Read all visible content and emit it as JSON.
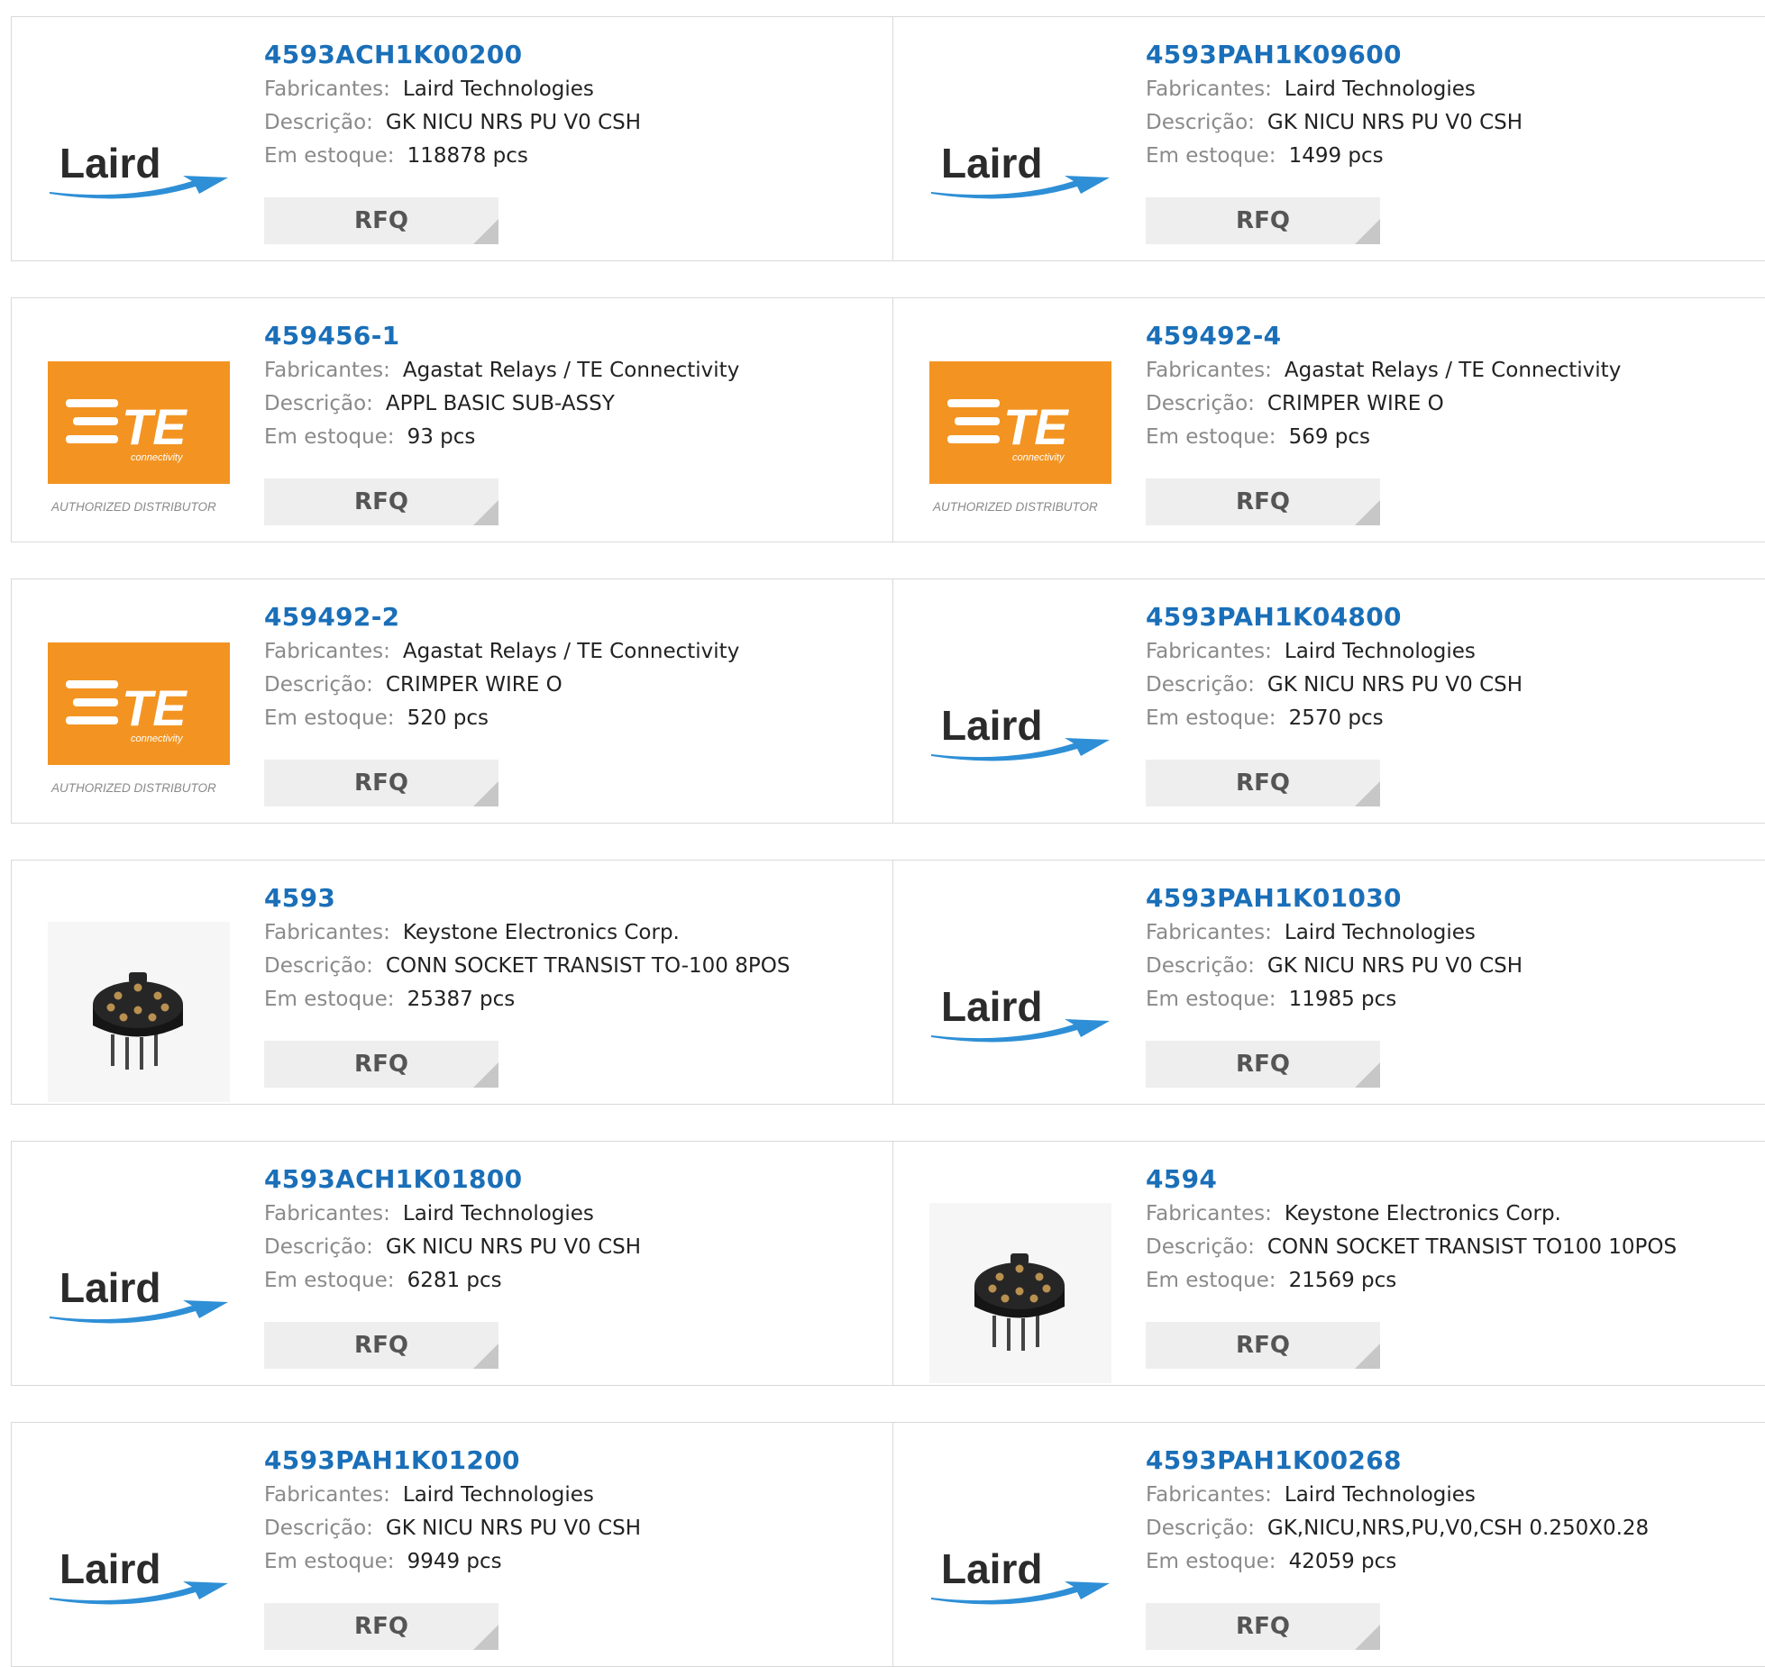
{
  "labels": {
    "manufacturer": "Fabricantes:",
    "description": "Descrição:",
    "stock": "Em estoque:",
    "rfq": "RFQ"
  },
  "logo_text": {
    "laird": "Laird",
    "te": "TE",
    "te_sub": "connectivity",
    "te_tagline": "AUTHORIZED DISTRIBUTOR"
  },
  "products": [
    {
      "part": "4593ACH1K00200",
      "manufacturer": "Laird Technologies",
      "description": "GK NICU NRS PU V0 CSH",
      "stock": "118878 pcs",
      "logo": "laird-logo"
    },
    {
      "part": "4593PAH1K09600",
      "manufacturer": "Laird Technologies",
      "description": "GK NICU NRS PU V0 CSH",
      "stock": "1499 pcs",
      "logo": "laird-logo"
    },
    {
      "part": "459456-1",
      "manufacturer": "Agastat Relays / TE Connectivity",
      "description": "APPL BASIC SUB-ASSY",
      "stock": "93 pcs",
      "logo": "te-logo"
    },
    {
      "part": "459492-4",
      "manufacturer": "Agastat Relays / TE Connectivity",
      "description": "CRIMPER WIRE O",
      "stock": "569 pcs",
      "logo": "te-logo"
    },
    {
      "part": "459492-2",
      "manufacturer": "Agastat Relays / TE Connectivity",
      "description": "CRIMPER WIRE O",
      "stock": "520 pcs",
      "logo": "te-logo"
    },
    {
      "part": "4593PAH1K04800",
      "manufacturer": "Laird Technologies",
      "description": "GK NICU NRS PU V0 CSH",
      "stock": "2570 pcs",
      "logo": "laird-logo"
    },
    {
      "part": "4593",
      "manufacturer": "Keystone Electronics Corp.",
      "description": "CONN SOCKET TRANSIST TO-100 8POS",
      "stock": "25387 pcs",
      "logo": "socket-image"
    },
    {
      "part": "4593PAH1K01030",
      "manufacturer": "Laird Technologies",
      "description": "GK NICU NRS PU V0 CSH",
      "stock": "11985 pcs",
      "logo": "laird-logo"
    },
    {
      "part": "4593ACH1K01800",
      "manufacturer": "Laird Technologies",
      "description": "GK NICU NRS PU V0 CSH",
      "stock": "6281 pcs",
      "logo": "laird-logo"
    },
    {
      "part": "4594",
      "manufacturer": "Keystone Electronics Corp.",
      "description": "CONN SOCKET TRANSIST TO100 10POS",
      "stock": "21569 pcs",
      "logo": "socket-image"
    },
    {
      "part": "4593PAH1K01200",
      "manufacturer": "Laird Technologies",
      "description": "GK NICU NRS PU V0 CSH",
      "stock": "9949 pcs",
      "logo": "laird-logo"
    },
    {
      "part": "4593PAH1K00268",
      "manufacturer": "Laird Technologies",
      "description": "GK,NICU,NRS,PU,V0,CSH 0.250X0.28",
      "stock": "42059 pcs",
      "logo": "laird-logo"
    }
  ]
}
